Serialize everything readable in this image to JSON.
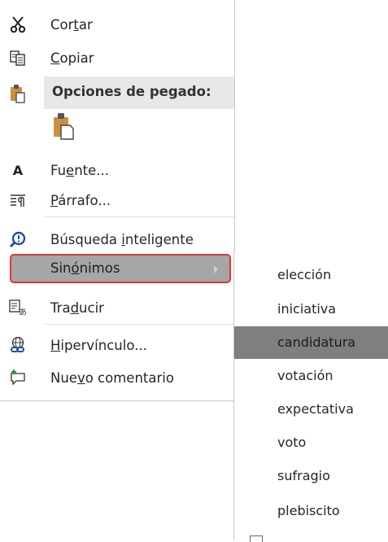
{
  "menu": {
    "items": [
      {
        "name": "cut",
        "pre": "Cor",
        "u": "t",
        "post": "ar",
        "icon": "scissors-icon"
      },
      {
        "name": "copy",
        "pre": "",
        "u": "C",
        "post": "opiar",
        "icon": "copy-icon"
      },
      {
        "name": "paste-options",
        "label": "Opciones de pegado:",
        "icon": "clipboard-icon"
      },
      {
        "name": "font",
        "pre": "Fu",
        "u": "e",
        "post": "nte...",
        "icon": "font-icon"
      },
      {
        "name": "paragraph",
        "pre": "",
        "u": "P",
        "post": "árrafo...",
        "icon": "paragraph-icon"
      },
      {
        "name": "smart-lookup",
        "pre": "Búsqueda ",
        "u": "i",
        "post": "nteligente",
        "icon": "search-icon"
      },
      {
        "name": "synonyms",
        "pre": "Sin",
        "u": "ó",
        "post": "nimos",
        "icon": ""
      },
      {
        "name": "translate",
        "pre": "Tra",
        "u": "d",
        "post": "ucir",
        "icon": "translate-icon"
      },
      {
        "name": "hyperlink",
        "pre": "",
        "u": "H",
        "post": "ipervínculo...",
        "icon": "link-icon"
      },
      {
        "name": "new-comment",
        "pre": "Nue",
        "u": "v",
        "post": "o comentario",
        "icon": "comment-icon"
      }
    ]
  },
  "submenu": {
    "items": [
      "elección",
      "iniciativa",
      "candidatura",
      "votación",
      "expectativa",
      "voto",
      "sufragio",
      "plebiscito"
    ],
    "selected": "candidatura"
  },
  "colors": {
    "highlight": "#a6a6a6",
    "selected": "#7f7f7f",
    "focus_border": "#e8322f",
    "header_bg": "#e8e8e8"
  }
}
